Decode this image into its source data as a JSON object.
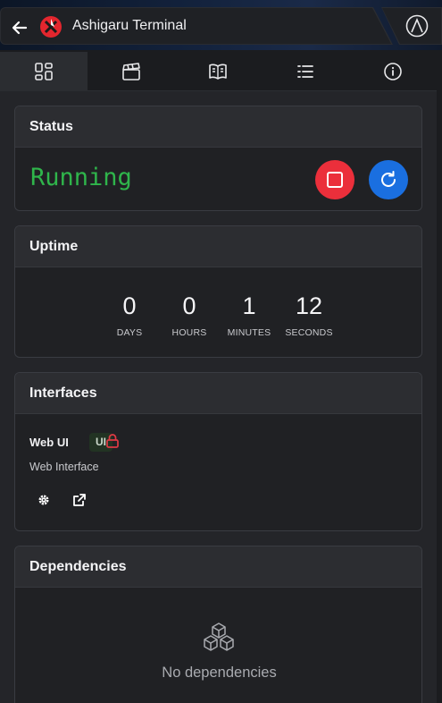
{
  "header": {
    "title": "Ashigaru Terminal",
    "back_icon": "arrow-left-icon",
    "logo_icon": "ashigaru-logo-icon",
    "corner_icon": "start9-logo-icon"
  },
  "tabs": [
    {
      "id": "dashboard",
      "icon": "dashboard-grid-icon",
      "active": true
    },
    {
      "id": "actions",
      "icon": "clapperboard-icon",
      "active": false
    },
    {
      "id": "instructions",
      "icon": "book-open-icon",
      "active": false
    },
    {
      "id": "logs",
      "icon": "list-icon",
      "active": false
    },
    {
      "id": "info",
      "icon": "info-circle-icon",
      "active": false
    }
  ],
  "status": {
    "heading": "Status",
    "value": "Running",
    "value_color": "#2fb54b",
    "stop_color": "#eb2f3b",
    "restart_color": "#1a6fe0"
  },
  "uptime": {
    "heading": "Uptime",
    "units": [
      {
        "value": "0",
        "label": "DAYS"
      },
      {
        "value": "0",
        "label": "HOURS"
      },
      {
        "value": "1",
        "label": "MINUTES"
      },
      {
        "value": "12",
        "label": "SECONDS"
      }
    ]
  },
  "interfaces": {
    "heading": "Interfaces",
    "items": [
      {
        "name": "Web UI",
        "badge": "UI",
        "description": "Web Interface",
        "lock_color": "#e03a44"
      }
    ]
  },
  "dependencies": {
    "heading": "Dependencies",
    "empty_text": "No dependencies"
  }
}
